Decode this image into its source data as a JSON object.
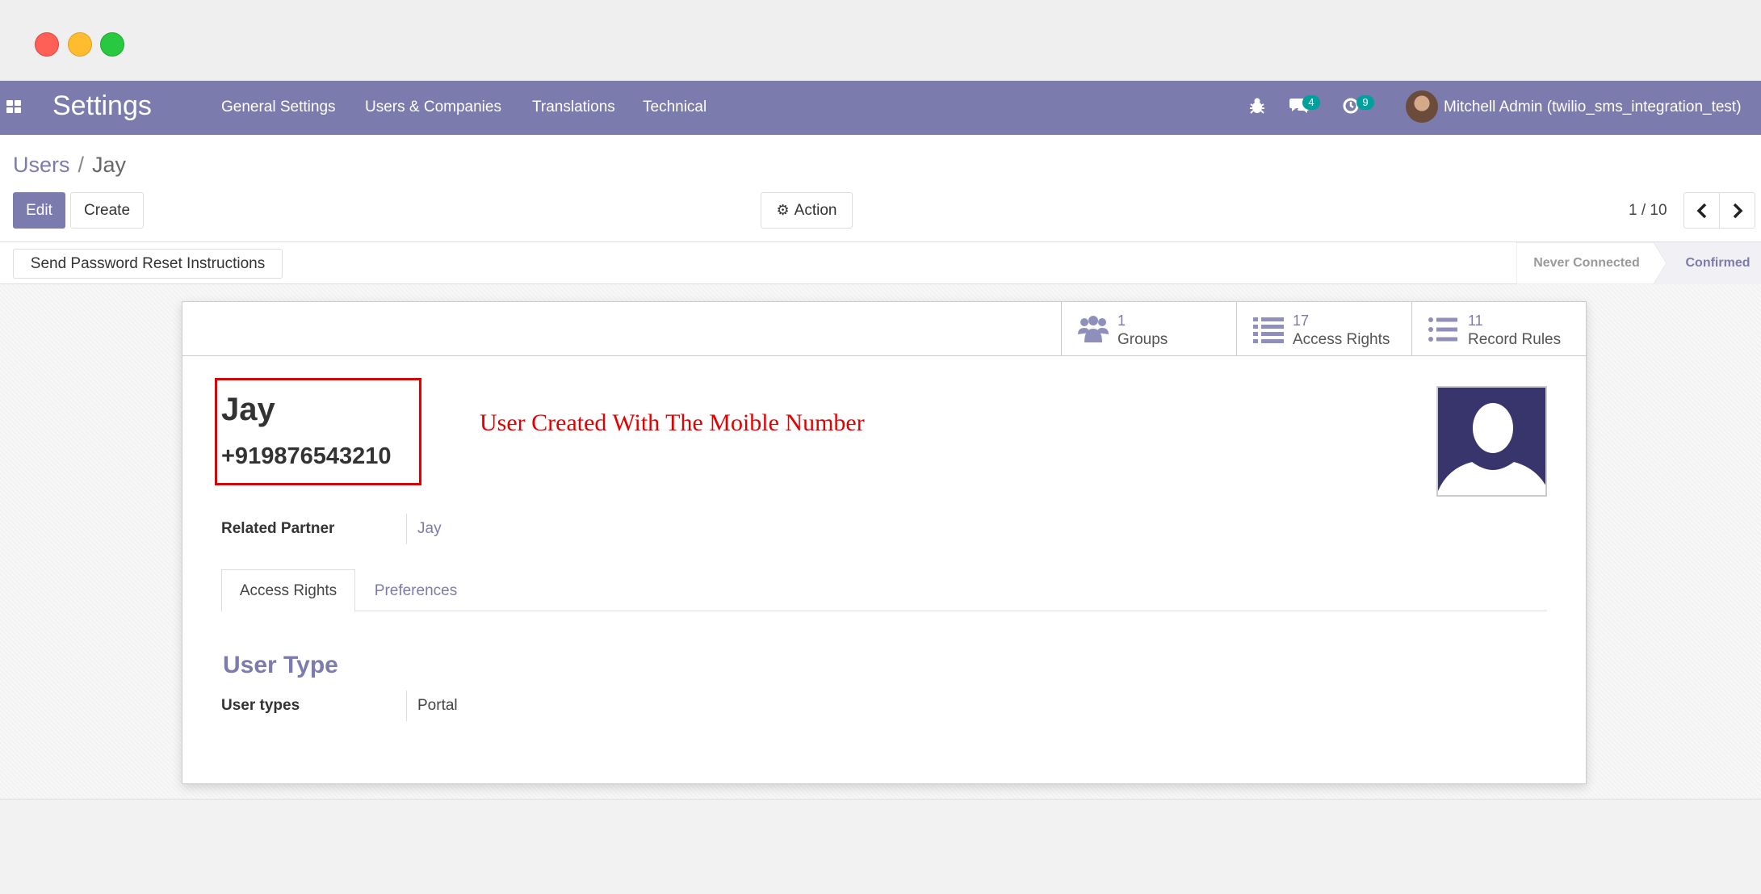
{
  "navbar": {
    "app_title": "Settings",
    "menu": [
      "General Settings",
      "Users & Companies",
      "Translations",
      "Technical"
    ],
    "messages_badge": "4",
    "activities_badge": "9",
    "user_name": "Mitchell Admin (twilio_sms_integration_test)"
  },
  "breadcrumb": {
    "parent": "Users",
    "separator": "/",
    "current": "Jay"
  },
  "toolbar": {
    "edit_label": "Edit",
    "create_label": "Create",
    "action_label": "Action"
  },
  "pager": {
    "value": "1 / 10"
  },
  "statusbar": {
    "reset_button": "Send Password Reset Instructions",
    "stages": [
      "Never Connected",
      "Confirmed"
    ],
    "active_stage": "Confirmed"
  },
  "smart_buttons": [
    {
      "count": "1",
      "label": "Groups",
      "icon": "users-icon"
    },
    {
      "count": "17",
      "label": "Access Rights",
      "icon": "list-icon"
    },
    {
      "count": "11",
      "label": "Record Rules",
      "icon": "list-icon"
    }
  ],
  "record": {
    "name": "Jay",
    "phone": "+919876543210",
    "annotation": "User Created With The Moible Number",
    "related_partner_label": "Related Partner",
    "related_partner_value": "Jay"
  },
  "tabs": [
    "Access Rights",
    "Preferences"
  ],
  "user_type": {
    "section_title": "User Type",
    "label": "User types",
    "value": "Portal"
  },
  "colors": {
    "brand": "#7c7bad",
    "annotation": "#e20000",
    "badge": "#00a09d"
  }
}
